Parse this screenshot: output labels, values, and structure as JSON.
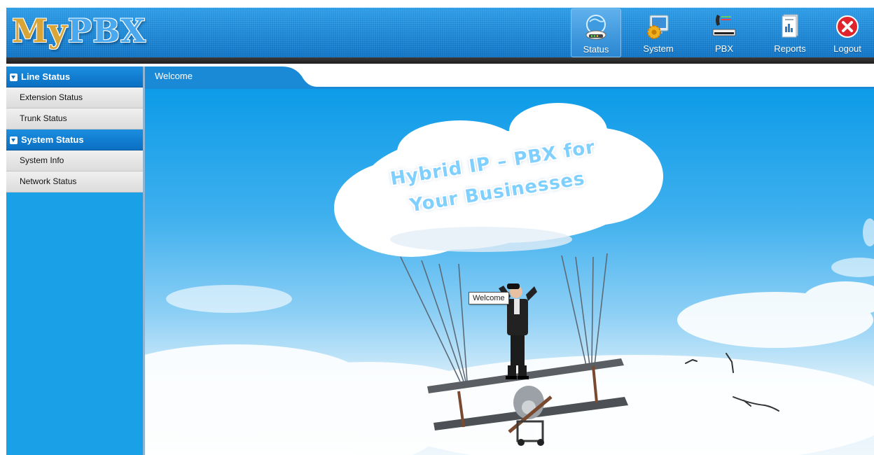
{
  "header": {
    "logo_left": "My",
    "logo_right": "PBX",
    "nav": [
      {
        "label": "Status",
        "icon": "status-globe-icon"
      },
      {
        "label": "System",
        "icon": "system-gear-icon"
      },
      {
        "label": "PBX",
        "icon": "pbx-phone-icon"
      },
      {
        "label": "Reports",
        "icon": "reports-chart-icon"
      },
      {
        "label": "Logout",
        "icon": "logout-x-icon"
      }
    ],
    "active_nav": "Status"
  },
  "sidebar": {
    "sections": [
      {
        "title": "Line Status",
        "items": [
          "Extension Status",
          "Trunk Status"
        ]
      },
      {
        "title": "System Status",
        "items": [
          "System Info",
          "Network Status"
        ]
      }
    ]
  },
  "content": {
    "tab_label": "Welcome",
    "banner_line1": "Hybrid IP – PBX for",
    "banner_line2": "Your Businesses",
    "tooltip": "Welcome"
  },
  "colors": {
    "header_blue": "#1a86d6",
    "sidebar_blue": "#1aa0e6",
    "section_header_blue": "#0a6fc2",
    "logo_gold": "#d9a537",
    "logout_red": "#e0242c"
  }
}
